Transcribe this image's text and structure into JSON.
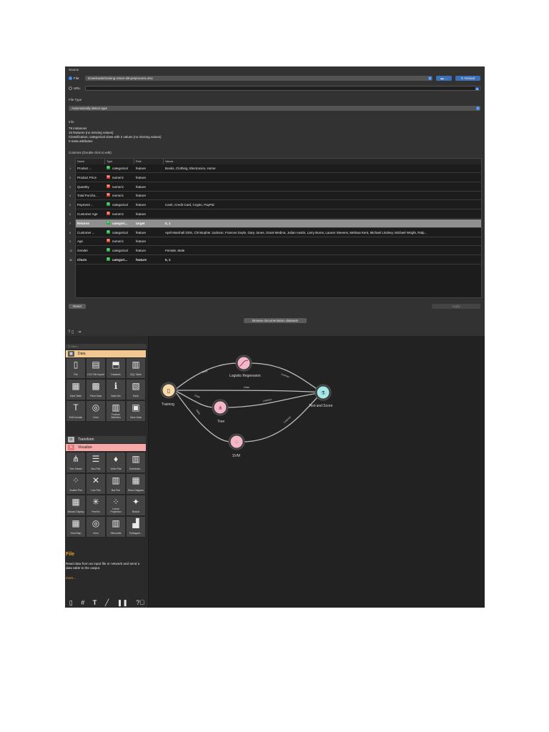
{
  "source": {
    "section_label": "Source",
    "file_radio_label": "File:",
    "file_path": "Downloads/training-return-d8-preprocess.xlsx",
    "browse_label": "...",
    "reload_label": "Reload",
    "url_radio_label": "URL:"
  },
  "file_type": {
    "section_label": "File Type",
    "selected": "Automatically detect type"
  },
  "info": {
    "section_label": "Info",
    "lines": [
      "79 instances",
      "10 features (no missing values)",
      "Classification; categorical class with 2 values (no missing values)",
      "0 meta attributes"
    ]
  },
  "columns": {
    "section_label": "Columns (Double click to edit)",
    "headers": [
      "Name",
      "Type",
      "Role",
      "Values"
    ],
    "rows": [
      {
        "num": "1",
        "name": "Product ...",
        "type": "categorical",
        "kind": "c",
        "role": "feature",
        "values": "Books, Clothing, Electronics, Home"
      },
      {
        "num": "2",
        "name": "Product Price",
        "type": "numeric",
        "kind": "n",
        "role": "feature",
        "values": ""
      },
      {
        "num": "3",
        "name": "Quantity",
        "type": "numeric",
        "kind": "n",
        "role": "feature",
        "values": ""
      },
      {
        "num": "4",
        "name": "Total Purcha...",
        "type": "numeric",
        "kind": "n",
        "role": "feature",
        "values": ""
      },
      {
        "num": "5",
        "name": "Payment ...",
        "type": "categorical",
        "kind": "c",
        "role": "feature",
        "values": "Cash, Credit Card, Crypto, PayPal"
      },
      {
        "num": "6",
        "name": "Customer Age",
        "type": "numeric",
        "kind": "n",
        "role": "feature",
        "values": ""
      },
      {
        "num": "7",
        "name": "Returns",
        "type": "categori...",
        "kind": "c",
        "role": "target",
        "values": "0, 1"
      },
      {
        "num": "8",
        "name": "Customer ...",
        "type": "categorical",
        "kind": "c",
        "role": "feature",
        "values": "April Marshall DDS, Christopher Jackson, Frances Doyle, Gary Jones, Grant Medina, Julian Austin, Larry Burns, Lauren Stevens, Melissa Kent, Michael Lindsey, Michael Wright, Ralp..."
      },
      {
        "num": "9",
        "name": "Age",
        "type": "numeric",
        "kind": "n",
        "role": "feature",
        "values": ""
      },
      {
        "num": "10",
        "name": "Gender",
        "type": "categorical",
        "kind": "c",
        "role": "feature",
        "values": "Female, Male"
      },
      {
        "num": "11",
        "name": "Churn",
        "type": "categori...",
        "kind": "c",
        "role": "feature",
        "values": "0, 1"
      }
    ]
  },
  "buttons": {
    "reset": "Reset",
    "apply": "Apply",
    "browse_docs": "Browse documentation datasets"
  },
  "toolbox": {
    "search_placeholder": "Filter...",
    "categories": {
      "data": "Data",
      "transform": "Transform",
      "visualize": "Visualize"
    },
    "data_widgets": [
      "File",
      "CSV File Import",
      "Datasets",
      "SQL Table",
      "Data Table",
      "Paint Data",
      "Data Info",
      "Rank",
      "Edit Domain",
      "Color",
      "Feature Statistics",
      "Save Data"
    ],
    "visualize_widgets": [
      "Tree Viewer",
      "Box Plot",
      "Violin Plot",
      "Distributio...",
      "Scatter Plot",
      "Line Plot",
      "Bar Plot",
      "Sieve Diagram",
      "Mosaic Display",
      "FreeViz",
      "Linear Projection",
      "Radviz",
      "Heat Map",
      "Venn",
      "Silhouette",
      "Pythagore..."
    ],
    "help": {
      "title": "File",
      "text": "Read data from an input file or network and send a data table to the output.",
      "more": "more..."
    }
  },
  "workflow": {
    "nodes": {
      "training": "Training",
      "logistic": "Logistic Regression",
      "tree": "Tree",
      "svm": "SVM",
      "test": "Test and Score"
    },
    "links": {
      "data": "Data",
      "learner": "Learner"
    },
    "colors": {
      "data_node": "#f7d9a8",
      "model_node": "#f5b8c8",
      "eval_node": "#a8e6e8"
    }
  }
}
